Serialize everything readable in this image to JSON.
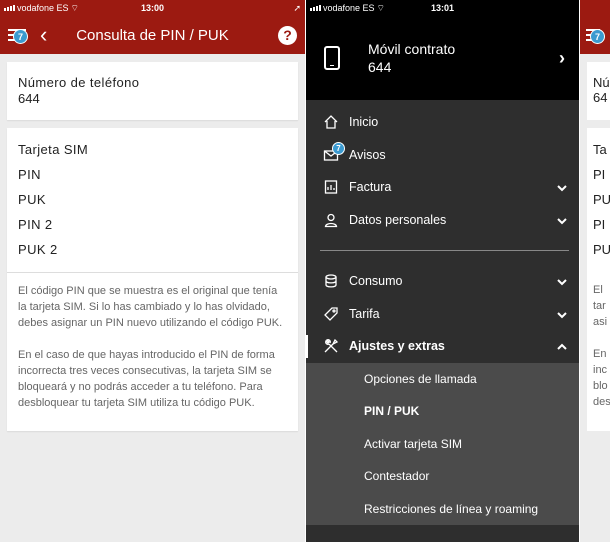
{
  "left": {
    "status": {
      "carrier": "vodafone ES",
      "time": "13:00"
    },
    "header": {
      "title": "Consulta de PIN / PUK",
      "badge": "7",
      "back": "‹",
      "help": "?"
    },
    "phone_card": {
      "label": "Número de teléfono",
      "value": "644"
    },
    "sim_card": {
      "items": [
        "Tarjeta SIM",
        "PIN",
        "PUK",
        "PIN 2",
        "PUK 2"
      ],
      "help1": "El código PIN que se muestra es el original que tenía la tarjeta SIM. Si lo has cambiado y lo has olvidado, debes asignar un PIN nuevo utilizando el código PUK.",
      "help2": "En el caso de que hayas introducido el PIN de forma incorrecta tres veces consecutivas, la tarjeta SIM se bloqueará y no podrás acceder a tu teléfono. Para desbloquear tu tarjeta SIM utiliza tu código PUK."
    }
  },
  "middle": {
    "status": {
      "carrier": "vodafone ES",
      "time": "13:01"
    },
    "account": {
      "name": "Móvil contrato",
      "number": "644"
    },
    "menu": {
      "inicio": "Inicio",
      "avisos": "Avisos",
      "avisos_badge": "7",
      "factura": "Factura",
      "datos": "Datos personales",
      "consumo": "Consumo",
      "tarifa": "Tarifa",
      "ajustes": "Ajustes y extras"
    },
    "submenu": [
      "Opciones de llamada",
      "PIN / PUK",
      "Activar tarjeta SIM",
      "Contestador",
      "Restricciones de línea y roaming"
    ]
  },
  "right": {
    "badge": "7",
    "phone_label": "Nú",
    "phone_value": "64",
    "items": [
      "Ta",
      "PI",
      "PU",
      "PI",
      "PU"
    ],
    "help1": [
      "El",
      "tar",
      "asi"
    ],
    "help2": [
      "En",
      "inc",
      "blo",
      "des"
    ]
  },
  "colors": {
    "brand_red": "#9c1a11",
    "badge_blue": "#3b9ad0",
    "menu_dark": "#2e2e2e"
  }
}
